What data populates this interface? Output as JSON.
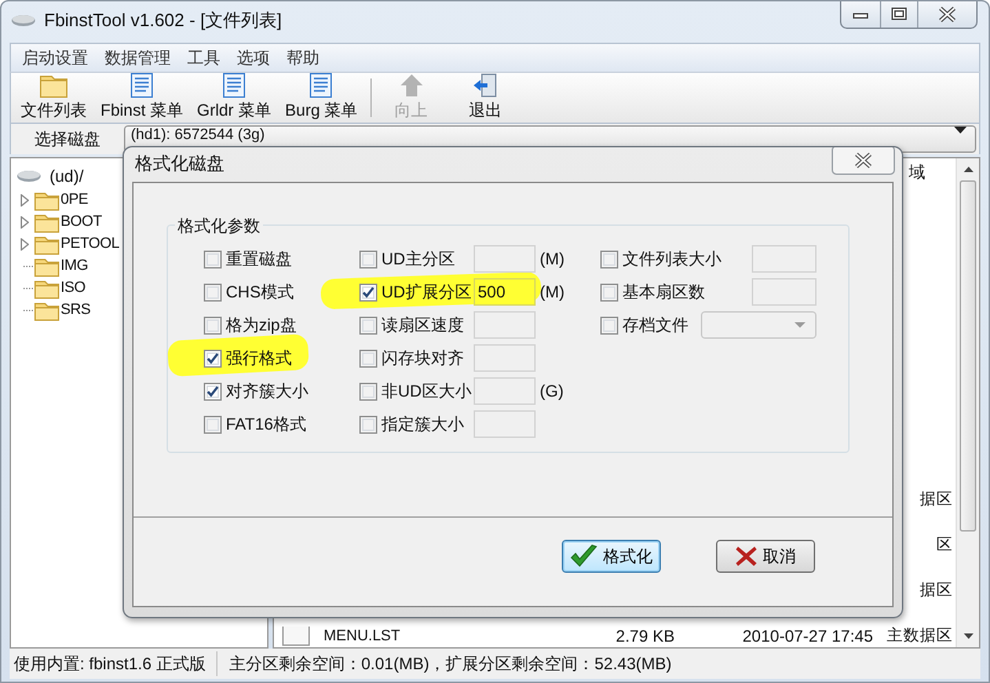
{
  "window": {
    "title": "FbinstTool v1.602 - [文件列表]"
  },
  "menu": [
    "启动设置",
    "数据管理",
    "工具",
    "选项",
    "帮助"
  ],
  "toolbar": {
    "groups": [
      [
        {
          "label": "文件列表",
          "disabled": false
        },
        {
          "label": "Fbinst 菜单",
          "disabled": false
        },
        {
          "label": "Grldr 菜单",
          "disabled": false
        },
        {
          "label": "Burg 菜单",
          "disabled": false
        }
      ],
      [
        {
          "label": "向上",
          "disabled": true
        },
        {
          "label": "退出",
          "disabled": false
        }
      ]
    ]
  },
  "disk": {
    "label": "选择磁盘",
    "value": "(hd1): 6572544 (3g)"
  },
  "tree": {
    "label": "(ud)/",
    "children": [
      {
        "label": "0PE",
        "expanded": false
      },
      {
        "label": "BOOT",
        "expanded": false
      },
      {
        "label": "PETOOL",
        "expanded": false
      },
      {
        "label": "IMG"
      },
      {
        "label": "ISO"
      },
      {
        "label": "SRS"
      }
    ]
  },
  "file_list": {
    "column_header": "域",
    "rows": [
      {
        "region": "据区"
      },
      {
        "region": "区"
      },
      {
        "region": "据区"
      },
      {
        "name": "MENU.LST",
        "size": "2.79 KB",
        "date": "2010-07-27 17:45",
        "region": "主数据区"
      }
    ]
  },
  "dialog": {
    "title": "格式化磁盘",
    "group_title": "格式化参数",
    "columns": [
      [
        {
          "kind": "checkbox",
          "label": "重置磁盘",
          "checked": false,
          "highlighted": false
        },
        {
          "kind": "checkbox",
          "label": "CHS模式",
          "checked": false,
          "highlighted": false
        },
        {
          "kind": "checkbox",
          "label": "格为zip盘",
          "checked": false,
          "highlighted": false
        },
        {
          "kind": "checkbox",
          "label": "强行格式",
          "checked": true,
          "highlighted": true
        },
        {
          "kind": "checkbox",
          "label": "对齐簇大小",
          "checked": true,
          "highlighted": false
        },
        {
          "kind": "checkbox",
          "label": "FAT16格式",
          "checked": false,
          "highlighted": false
        }
      ],
      [
        {
          "kind": "input",
          "label": "UD主分区",
          "checked": false,
          "highlighted": false,
          "unit": "(M)"
        },
        {
          "kind": "input",
          "label": "UD扩展分区",
          "checked": true,
          "highlighted": true,
          "value": "500",
          "unit": "(M)"
        },
        {
          "kind": "input",
          "label": "读扇区速度",
          "checked": false,
          "highlighted": false
        },
        {
          "kind": "input",
          "label": "闪存块对齐",
          "checked": false,
          "highlighted": false
        },
        {
          "kind": "input",
          "label": "非UD区大小",
          "checked": false,
          "highlighted": false,
          "unit": "(G)"
        },
        {
          "kind": "input",
          "label": "指定簇大小",
          "checked": false,
          "highlighted": false
        }
      ],
      [
        {
          "kind": "input",
          "label": "文件列表大小",
          "checked": false,
          "highlighted": false
        },
        {
          "kind": "input",
          "label": "基本扇区数",
          "checked": false,
          "highlighted": false
        },
        {
          "kind": "dropdown",
          "label": "存档文件",
          "checked": false,
          "highlighted": false
        }
      ]
    ],
    "buttons": [
      {
        "label": "格式化",
        "default": true
      },
      {
        "label": "取消",
        "default": false
      }
    ]
  },
  "status_bar": [
    "使用内置: fbinst1.6 正式版",
    "主分区剩余空间：0.01(MB)，扩展分区剩余空间：52.43(MB)"
  ]
}
